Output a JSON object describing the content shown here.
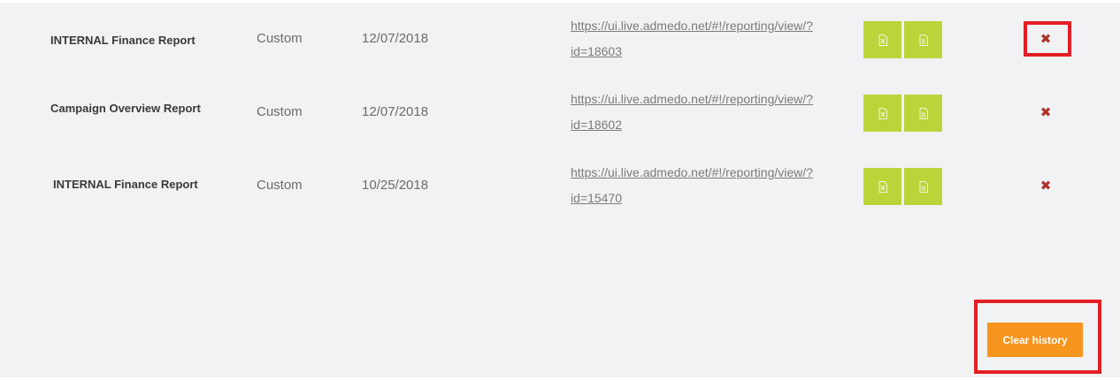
{
  "rows": [
    {
      "name": "INTERNAL Finance Report",
      "type": "Custom",
      "date": "12/07/2018",
      "link_line1": "https://ui.live.admedo.net/#!/reporting/view/?",
      "link_line2": "id=18603",
      "delete_icon": "✖"
    },
    {
      "name": "Campaign Overview Report",
      "type": "Custom",
      "date": "12/07/2018",
      "link_line1": "https://ui.live.admedo.net/#!/reporting/view/?",
      "link_line2": "id=18602",
      "delete_icon": "✖"
    },
    {
      "name": "INTERNAL Finance Report",
      "type": "Custom",
      "date": "10/25/2018",
      "link_line1": "https://ui.live.admedo.net/#!/reporting/view/?",
      "link_line2": "id=15470",
      "delete_icon": "✖"
    }
  ],
  "footer": {
    "clear_history_label": "Clear history"
  },
  "colors": {
    "panel_bg": "#f0f2f3",
    "action_green": "#b9d53a",
    "delete_red": "#b0302c",
    "clear_orange": "#f7941d",
    "highlight_red": "#e31e24"
  },
  "icons": {
    "excel_export": "excel-file-icon",
    "document_export": "document-file-icon",
    "delete": "close-icon"
  }
}
